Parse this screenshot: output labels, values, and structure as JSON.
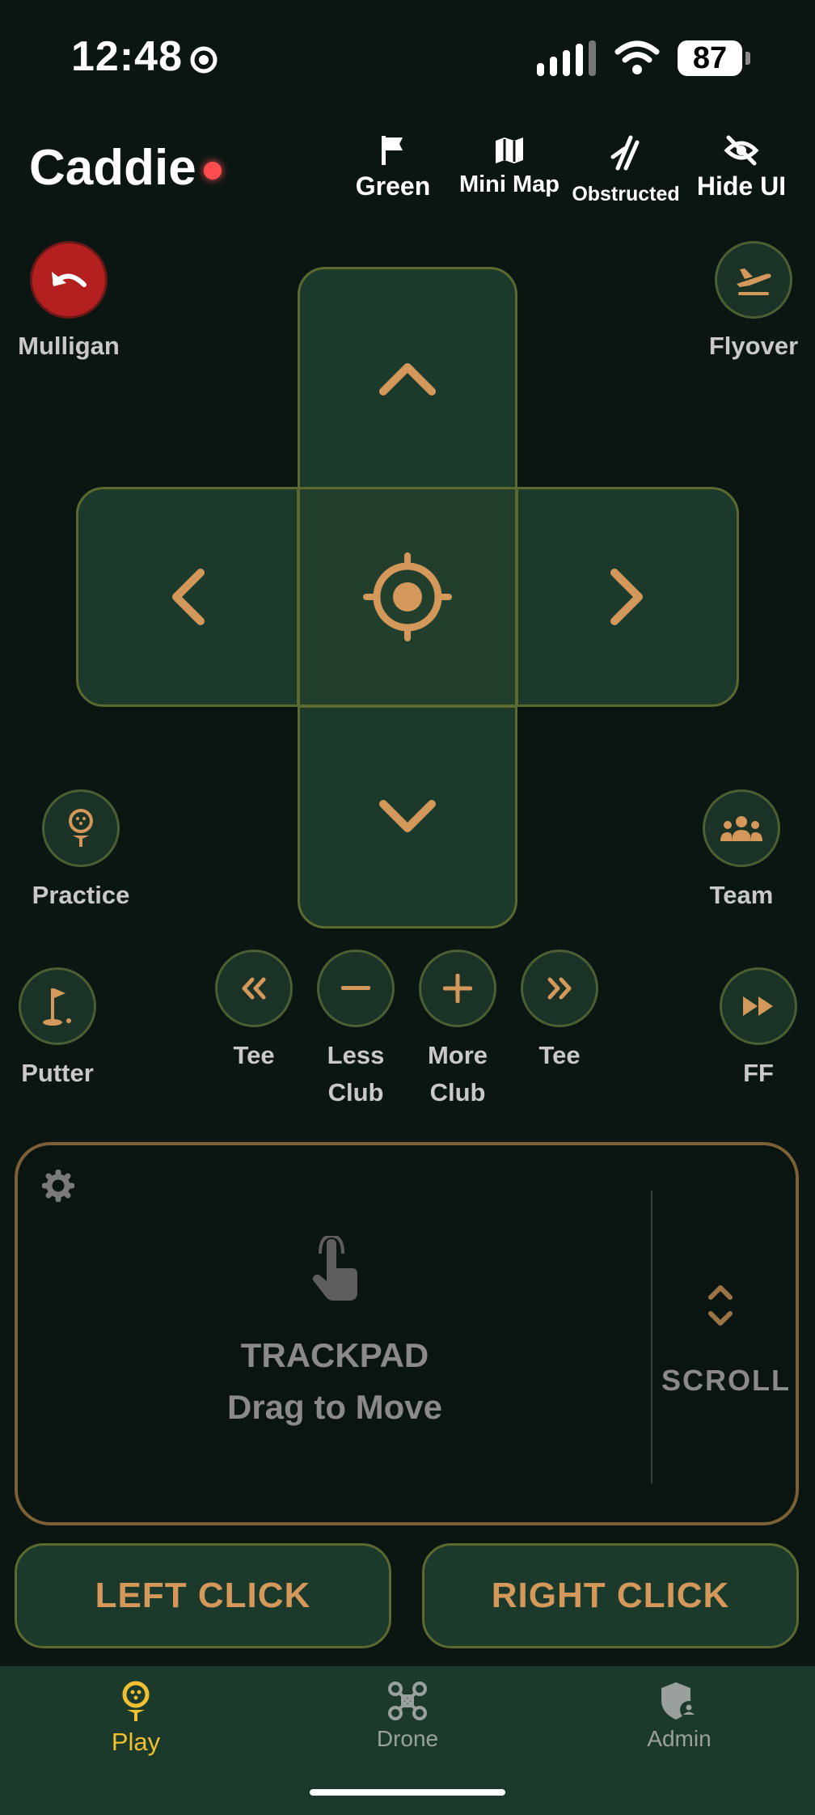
{
  "status": {
    "time": "12:48",
    "battery": "87"
  },
  "header": {
    "title": "Caddie",
    "buttons": {
      "green": "Green",
      "mini_map": "Mini Map",
      "obstructed": "Obstructed",
      "hide_ui": "Hide UI"
    }
  },
  "side_buttons": {
    "mulligan": "Mulligan",
    "flyover": "Flyover",
    "practice": "Practice",
    "team": "Team",
    "putter": "Putter",
    "ff": "FF"
  },
  "club_buttons": {
    "tee_prev": "Tee",
    "less_club": [
      "Less",
      "Club"
    ],
    "more_club": [
      "More",
      "Club"
    ],
    "tee_next": "Tee"
  },
  "trackpad": {
    "title": "TRACKPAD",
    "subtitle": "Drag to Move",
    "scroll": "SCROLL"
  },
  "clicks": {
    "left": "LEFT CLICK",
    "right": "RIGHT CLICK"
  },
  "nav": {
    "play": "Play",
    "drone": "Drone",
    "admin": "Admin",
    "active": "play"
  },
  "colors": {
    "accent": "#d4985a",
    "active_nav": "#f0c030",
    "pad_bg": "#1c3a2b",
    "record": "#ff4d4f"
  }
}
